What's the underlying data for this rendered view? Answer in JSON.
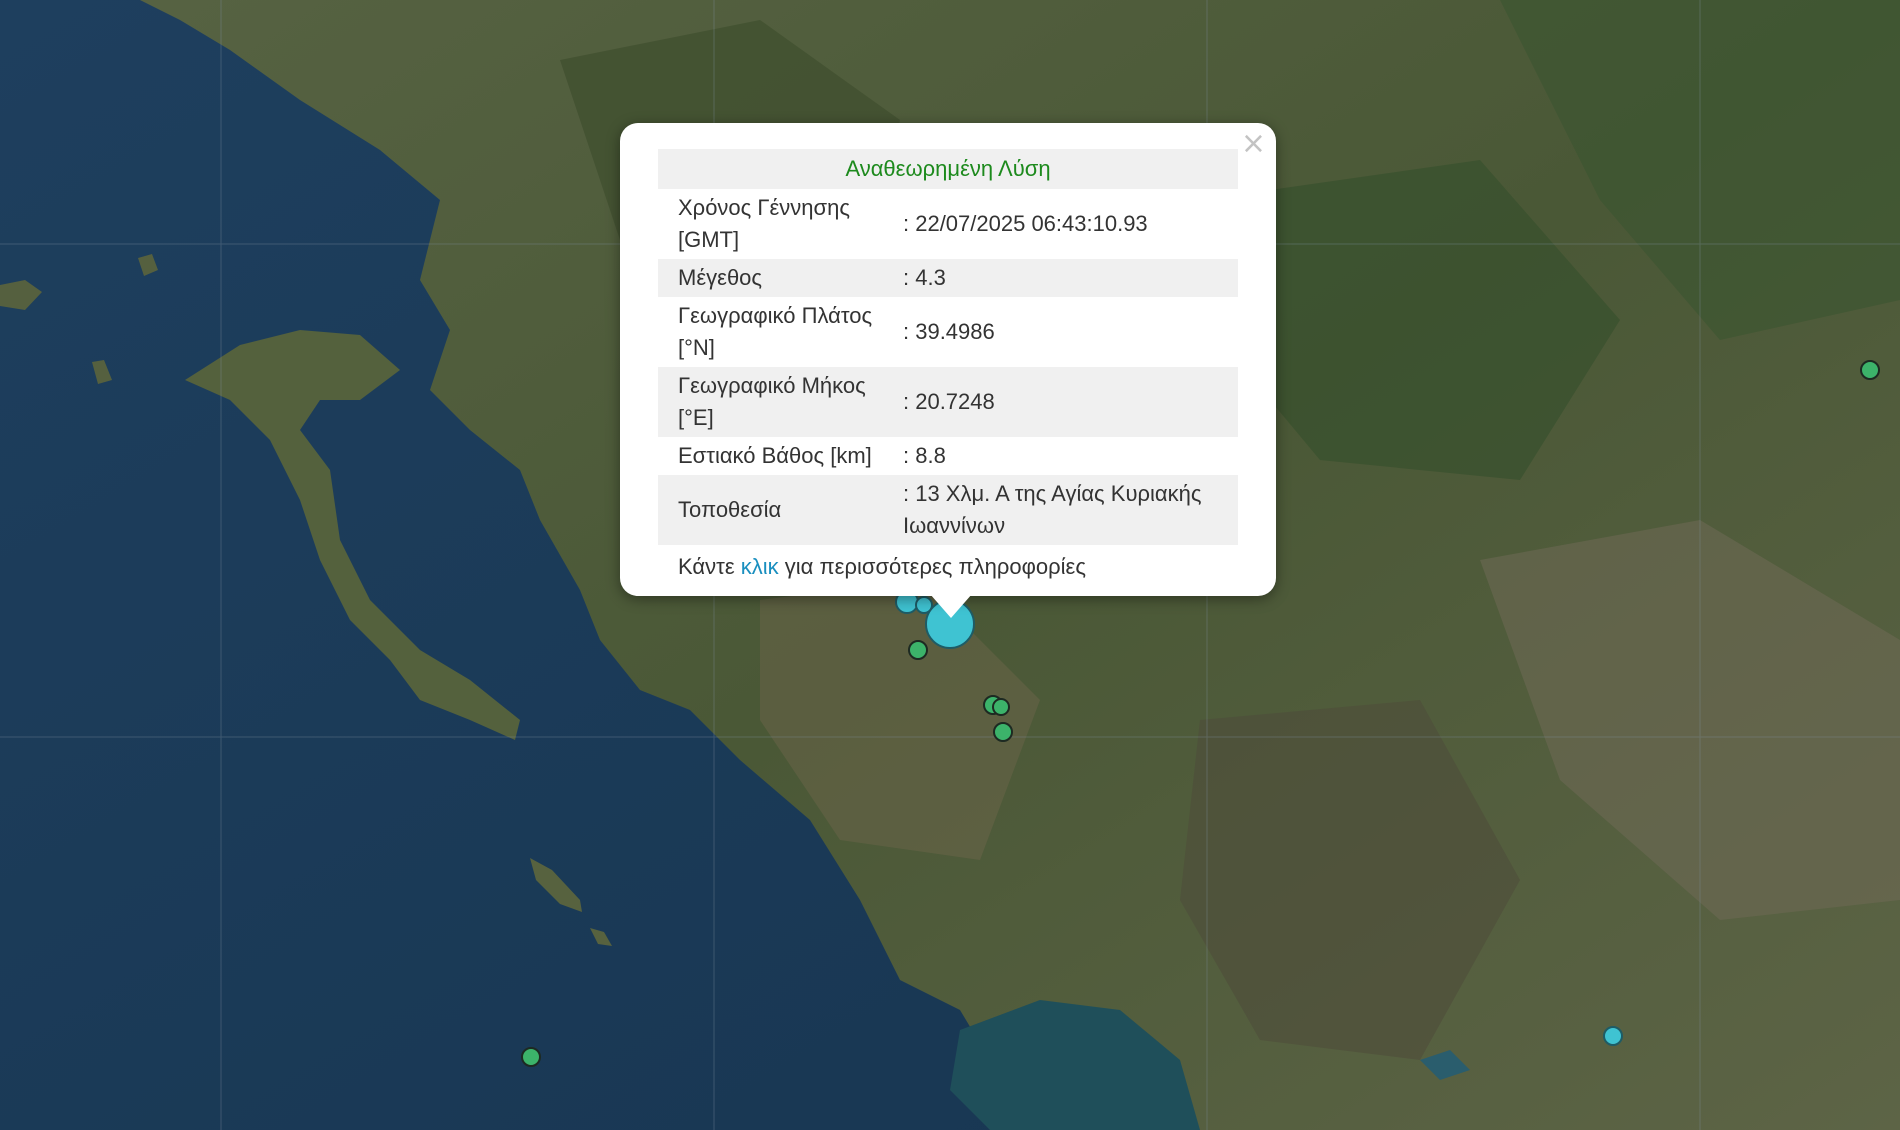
{
  "popup": {
    "title": "Αναθεωρημένη Λύση",
    "close_glyph": "×",
    "rows": [
      {
        "label": "Χρόνος Γέννησης [GMT]",
        "value": ": 22/07/2025 06:43:10.93"
      },
      {
        "label": "Μέγεθος",
        "value": ": 4.3"
      },
      {
        "label": "Γεωγραφικό Πλάτος [°N]",
        "value": ": 39.4986"
      },
      {
        "label": "Γεωγραφικό Μήκος [°E]",
        "value": ": 20.7248"
      },
      {
        "label": "Εστιακό Βάθος [km]",
        "value": ": 8.8"
      },
      {
        "label": "Τοποθεσία",
        "value": ": 13 Χλμ. Α της Αγίας Κυριακής Ιωαννίνων"
      }
    ],
    "more_prefix": "Κάντε",
    "more_link": "κλικ",
    "more_suffix": "για περισσότερες πληροφορίες"
  },
  "map": {
    "colors": {
      "sea": "#1b3a57",
      "land": "#4c5a36",
      "marker_green": "#3cb36a",
      "marker_cyan": "#3fc3d2",
      "popup_title": "#1d8a1d",
      "link": "#1a8fbf"
    }
  }
}
